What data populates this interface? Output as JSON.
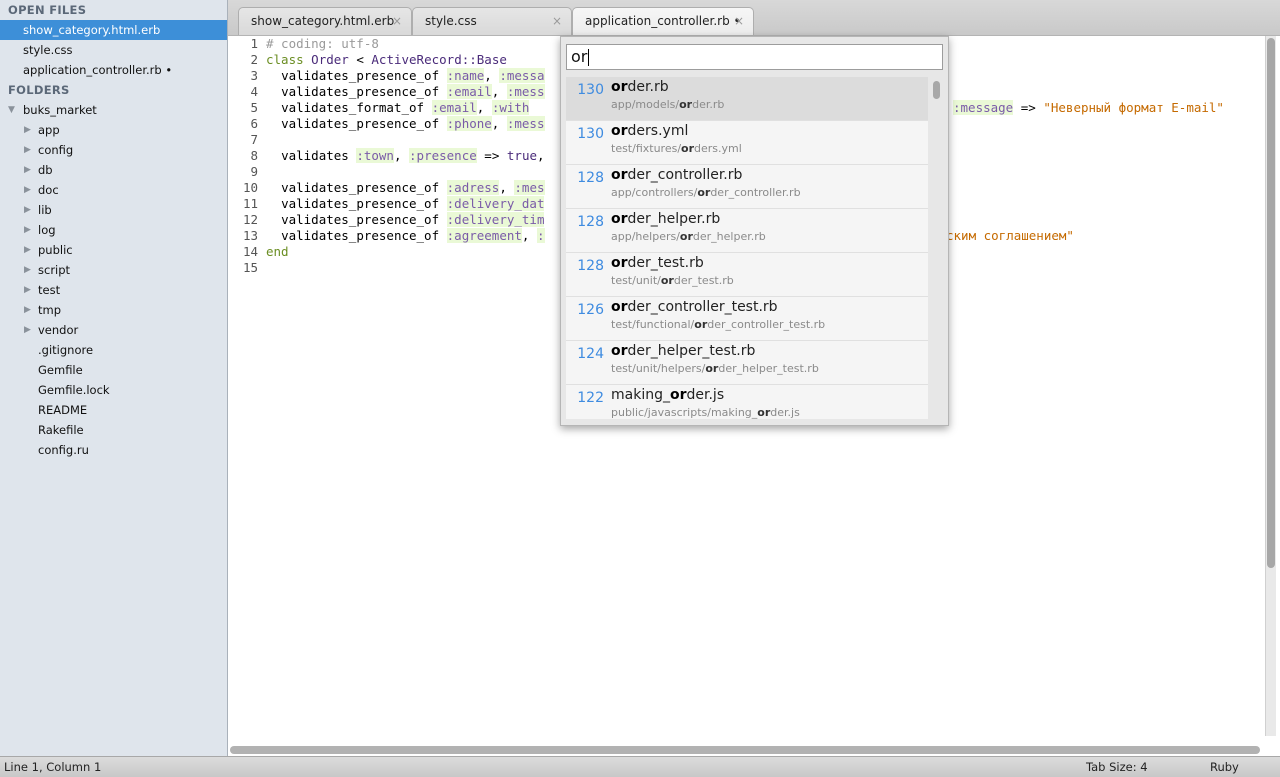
{
  "sidebar": {
    "open_files_header": "OPEN FILES",
    "open_files": [
      {
        "label": "show_category.html.erb"
      },
      {
        "label": "style.css"
      },
      {
        "label": "application_controller.rb •"
      }
    ],
    "folders_header": "FOLDERS",
    "root_folder": "buks_market",
    "folders": [
      "app",
      "config",
      "db",
      "doc",
      "lib",
      "log",
      "public",
      "script",
      "test",
      "tmp",
      "vendor"
    ],
    "files": [
      ".gitignore",
      "Gemfile",
      "Gemfile.lock",
      "README",
      "Rakefile",
      "config.ru"
    ]
  },
  "tabs": [
    {
      "label": "show_category.html.erb",
      "close": "×"
    },
    {
      "label": "style.css",
      "close": "×"
    },
    {
      "label": "application_controller.rb •",
      "close": "×"
    }
  ],
  "editor": {
    "line_numbers": [
      "1",
      "2",
      "3",
      "4",
      "5",
      "6",
      "7",
      "8",
      "9",
      "10",
      "11",
      "12",
      "13",
      "14",
      "15"
    ],
    "line1": "# coding: utf-8",
    "line2_kw": "class",
    "line2_class": "Order",
    "line2_op": "<",
    "line2_base": "ActiveRecord::Base",
    "line3_text": "validates_presence_of",
    "line3_sym1": ":name",
    "line3_sym2": ":messa",
    "line4_text": "validates_presence_of",
    "line4_sym1": ":email",
    "line4_sym2": ":mess",
    "line5_text": "validates_format_of",
    "line5_sym1": ":email",
    "line5_sym2": ":with",
    "line5_tail_sym": ":message",
    "line5_arrow": "=>",
    "line5_string": "\"Неверный формат E-mail\"",
    "line6_text": "validates_presence_of",
    "line6_sym1": ":phone",
    "line6_sym2": ":mess",
    "line8_text": "validates",
    "line8_sym1": ":town",
    "line8_sym2": ":presence",
    "line8_arrow": "=>",
    "line8_true": "true",
    "line10_text": "validates_presence_of",
    "line10_sym1": ":adress",
    "line10_sym2": ":mes",
    "line11_text": "validates_presence_of",
    "line11_sym1": ":delivery_dat",
    "line12_text": "validates_presence_of",
    "line12_sym1": ":delivery_tim",
    "line13_text": "validates_presence_of",
    "line13_sym1": ":agreement",
    "line13_sym2": ":",
    "line13_string": "ским соглашением\"",
    "line14": "end"
  },
  "quick_open": {
    "query": "or",
    "results": [
      {
        "score": "130",
        "name_hl": "or",
        "name_rest": "der.rb",
        "path_pre": "app/models/",
        "path_hl": "or",
        "path_post": "der.rb",
        "selected": true
      },
      {
        "score": "130",
        "name_hl": "or",
        "name_rest": "ders.yml",
        "path_pre": "test/fixtures/",
        "path_hl": "or",
        "path_post": "ders.yml"
      },
      {
        "score": "128",
        "name_hl": "or",
        "name_rest": "der_controller.rb",
        "path_pre": "app/controllers/",
        "path_hl": "or",
        "path_post": "der_controller.rb"
      },
      {
        "score": "128",
        "name_hl": "or",
        "name_rest": "der_helper.rb",
        "path_pre": "app/helpers/",
        "path_hl": "or",
        "path_post": "der_helper.rb"
      },
      {
        "score": "128",
        "name_hl": "or",
        "name_rest": "der_test.rb",
        "path_pre": "test/unit/",
        "path_hl": "or",
        "path_post": "der_test.rb"
      },
      {
        "score": "126",
        "name_hl": "or",
        "name_rest": "der_controller_test.rb",
        "path_pre": "test/functional/",
        "path_hl": "or",
        "path_post": "der_controller_test.rb"
      },
      {
        "score": "124",
        "name_hl": "or",
        "name_rest": "der_helper_test.rb",
        "path_pre": "test/unit/helpers/",
        "path_hl": "or",
        "path_post": "der_helper_test.rb"
      },
      {
        "score": "122",
        "name_pre": "making_",
        "name_hl": "or",
        "name_rest": "der.js",
        "path_pre": "public/javascripts/making_",
        "path_hl": "or",
        "path_post": "der.js"
      }
    ]
  },
  "status": {
    "position": "Line 1, Column 1",
    "tab_size": "Tab Size: 4",
    "syntax": "Ruby"
  },
  "colors": {
    "selection": "#3d8fd8",
    "score": "#3e8be0",
    "symbol_bg": "#eaf9d6",
    "string": "#c56a00"
  }
}
